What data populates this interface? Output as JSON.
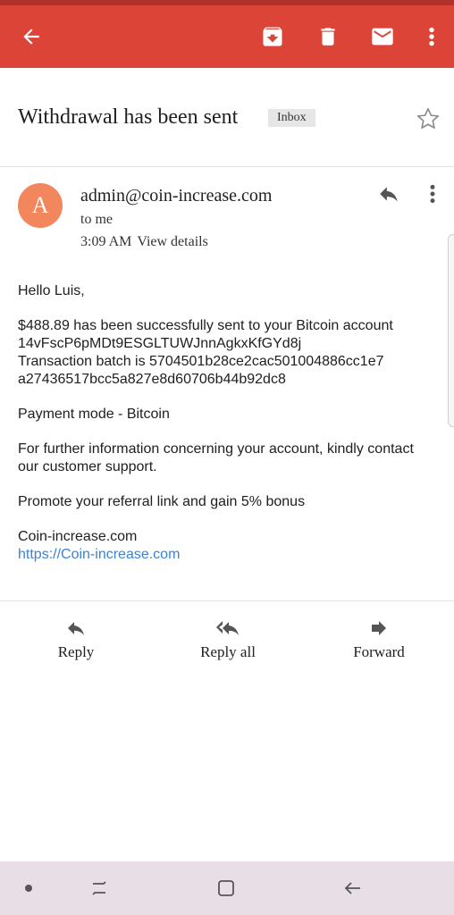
{
  "toolbar": {
    "back": "back-arrow-icon",
    "archive": "archive-icon",
    "delete": "trash-icon",
    "mark_unread": "mail-icon",
    "more": "more-vert-icon",
    "color": "#db4437"
  },
  "subject": {
    "title": "Withdrawal has been sent",
    "label": "Inbox"
  },
  "message": {
    "avatar_letter": "A",
    "avatar_color": "#f2865c",
    "sender": "admin@coin-increase.com",
    "to": "to me",
    "time": "3:09 AM",
    "view_details": "View details"
  },
  "body": {
    "greeting": "Hello Luis,",
    "line1": "$488.89 has been successfully sent to your Bitcoin account",
    "line2": "14vFscP6pMDt9ESGLTUWJnnAgkxKfGYd8j",
    "line3": "Transaction batch is 5704501b28ce2cac501004886cc1e7",
    "line4": "a27436517bcc5a827e8d60706b44b92dc8",
    "payment_mode": "Payment mode - Bitcoin",
    "info": "For further information concerning your account, kindly contact our customer support.",
    "promo": "Promote your referral link and gain 5% bonus",
    "signature": "Coin-increase.com",
    "link": "https://Coin-increase.com",
    "link_color": "#3b82d6"
  },
  "actions": {
    "reply": "Reply",
    "reply_all": "Reply all",
    "forward": "Forward"
  }
}
